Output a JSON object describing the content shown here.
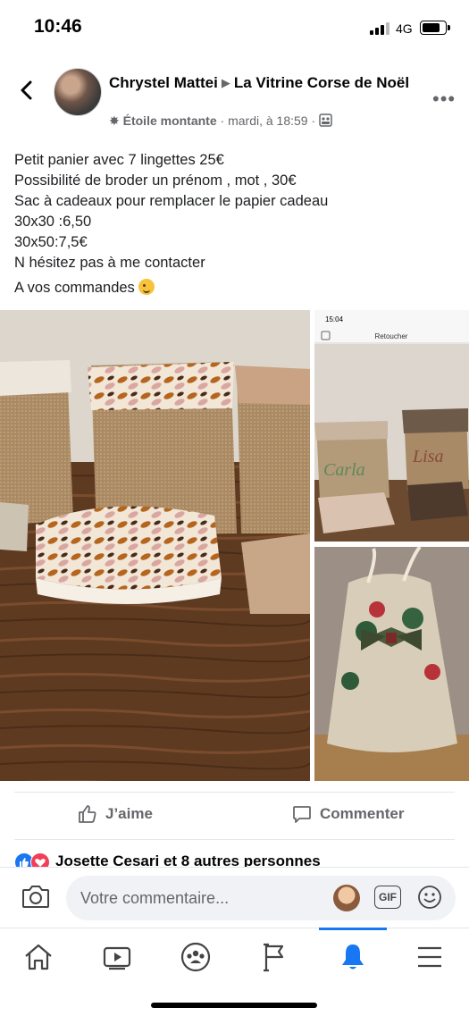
{
  "status_bar": {
    "time": "10:46",
    "network": "4G"
  },
  "post": {
    "author": "Chrystel Mattei",
    "group": "La Vitrine Corse de Noël",
    "badge": "Étoile montante",
    "time": "· mardi, à 18:59 ·",
    "text_lines": [
      "Petit panier avec 7 lingettes 25€",
      "Possibilité de broder un prénom , mot , 30€",
      "Sac à cadeaux pour remplacer le papier cadeau",
      "30x30 :6,50",
      "30x50:7,5€",
      "N hésitez pas à me contacter",
      "A vos commandes"
    ]
  },
  "photos": {
    "inset_time": "15:04",
    "inset_title": "Retoucher",
    "embroidery_1": "Carla",
    "embroidery_2": "Lisa"
  },
  "actions": {
    "like": "J’aime",
    "comment": "Commenter"
  },
  "reactions": {
    "text": "Josette Cesari et 8 autres personnes"
  },
  "comment_bar": {
    "placeholder": "Votre commentaire...",
    "gif": "GIF"
  },
  "colors": {
    "accent": "#1877f2",
    "secondary_text": "#65676b",
    "love": "#f33e58"
  },
  "tabs": [
    "home-icon",
    "video-icon",
    "groups-icon",
    "pages-flag-icon",
    "notifications-bell-icon",
    "menu-icon"
  ]
}
